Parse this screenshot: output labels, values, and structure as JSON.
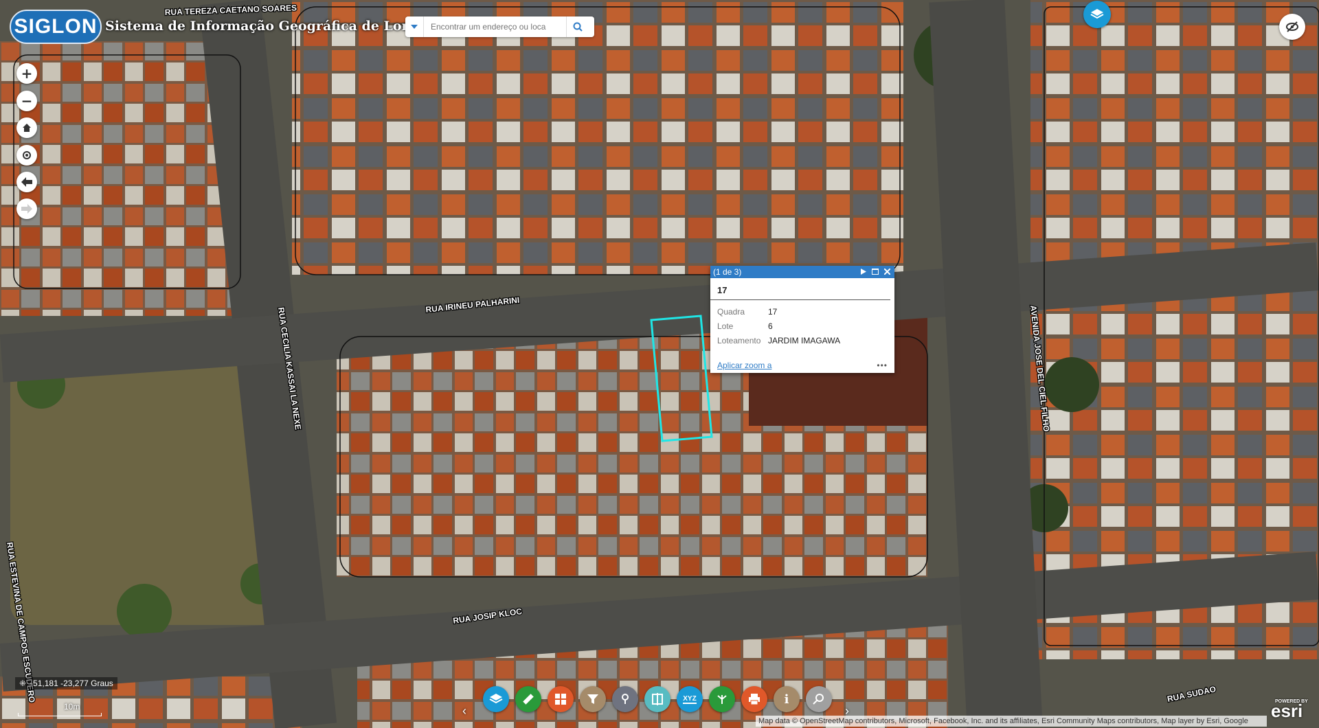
{
  "header": {
    "logo_text": "SIGLON",
    "app_title": "Sistema de Informação Geográfica de Londrina"
  },
  "search": {
    "placeholder": "Encontrar um endereço ou loca"
  },
  "map": {
    "streets": [
      "RUA IRINEU PALHARINI",
      "RUA CECILIA KASSAI LA NEXE",
      "RUA ESTEVINA DE CAMPOS ESCUDERO",
      "RUA JOSIP KLOC",
      "AVENIDA JOSE DEL CIEL FILHO",
      "RUA SUDAO",
      "RUA TEREZA CAETANO SOARES"
    ]
  },
  "popup": {
    "counter": "(1 de 3)",
    "title": "17",
    "attributes": [
      {
        "key": "Quadra",
        "value": "17"
      },
      {
        "key": "Lote",
        "value": "6"
      },
      {
        "key": "Loteamento",
        "value": "JARDIM IMAGAWA"
      }
    ],
    "zoom_link": "Aplicar zoom a",
    "more": "•••"
  },
  "status": {
    "coordinates": "-51,181 -23,277 Graus",
    "scale": "10m"
  },
  "toolbar": {
    "colors": [
      "#1a9ad6",
      "#2a9a3a",
      "#e0582a",
      "#a58b6a",
      "#6f7380",
      "#58bcc2",
      "#1a9ad6",
      "#2a9a3a",
      "#e0582a",
      "#a58b6a",
      "#a0a0a0"
    ],
    "icons": [
      "layers-icon",
      "measure-icon",
      "basemap-gallery-icon",
      "filter-icon",
      "routing-icon",
      "swipe-icon",
      "xyz-icon",
      "share-icon",
      "print-icon",
      "info-icon",
      "zoom-search-icon"
    ],
    "xyz_label": "XYZ"
  },
  "attribution": "Map data © OpenStreetMap contributors, Microsoft, Facebook, Inc. and its affiliates, Esri Community Maps contributors, Map layer by Esri, Google",
  "esri": {
    "powered": "POWERED BY",
    "logo": "esri"
  }
}
